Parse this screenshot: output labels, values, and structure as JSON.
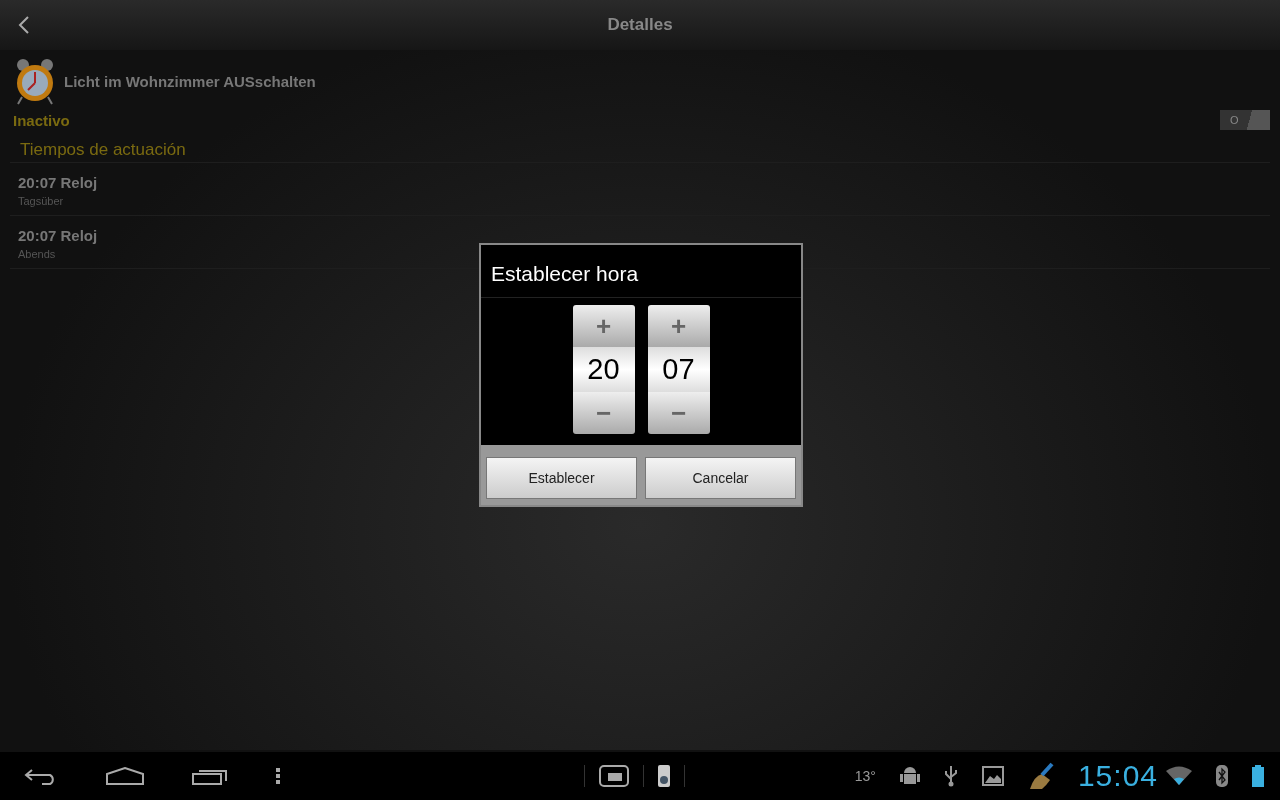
{
  "action_bar": {
    "title": "Detalles"
  },
  "task": {
    "name": "Licht im Wohnzimmer AUSschalten",
    "status": "Inactivo",
    "toggle": {
      "label": "O",
      "on": false
    }
  },
  "section": {
    "title": "Tiempos de actuación"
  },
  "times": [
    {
      "title": "20:07 Reloj",
      "subtitle": "Tagsüber"
    },
    {
      "title": "20:07 Reloj",
      "subtitle": "Abends"
    }
  ],
  "dialog": {
    "title": "Establecer hora",
    "pickers": [
      {
        "value": "20",
        "plus": "+",
        "minus": "−"
      },
      {
        "value": "07",
        "plus": "+",
        "minus": "−"
      }
    ],
    "buttons": [
      "Establecer",
      "Cancelar"
    ]
  },
  "status_bar": {
    "temperature": "13°",
    "clock": "15:04"
  }
}
